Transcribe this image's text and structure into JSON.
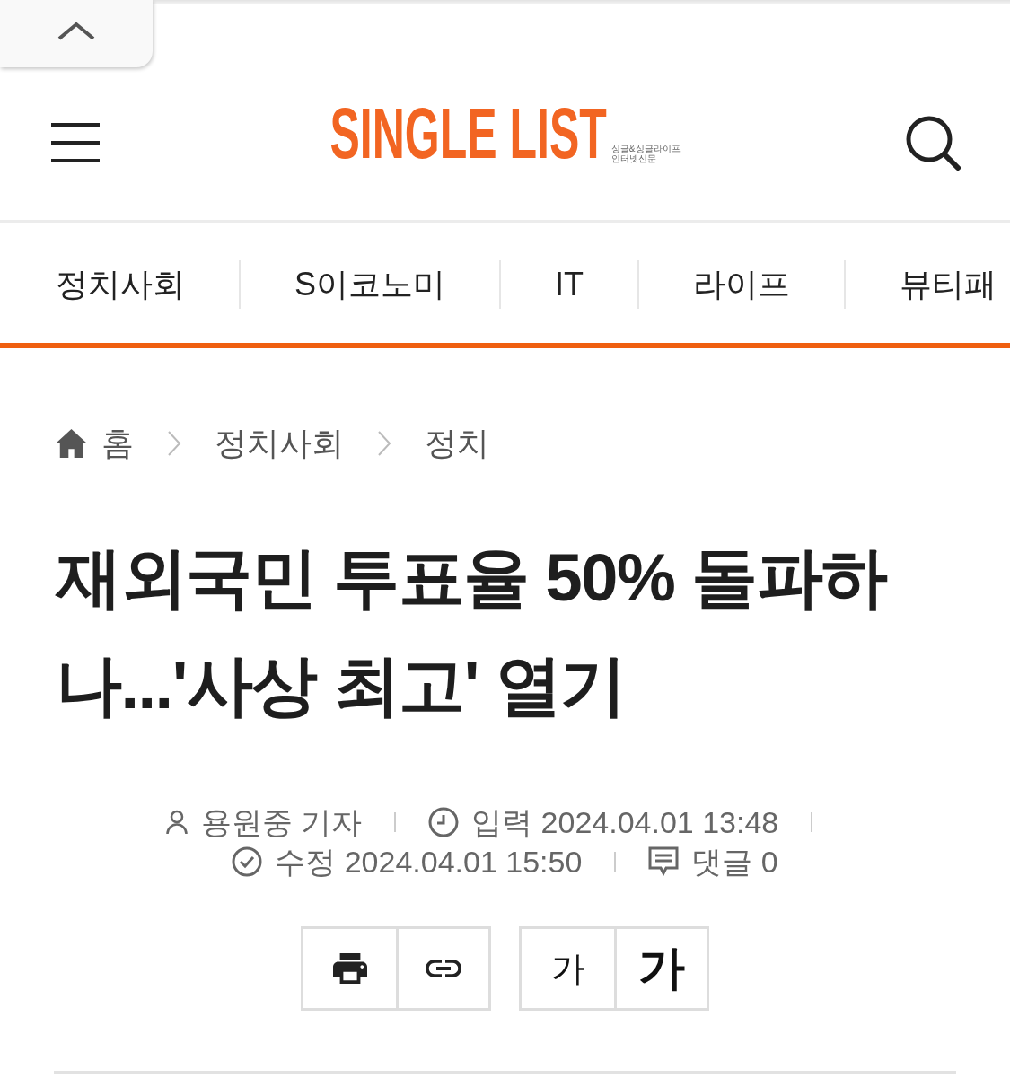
{
  "header": {
    "logo": {
      "wordmark": "SINGLE LIST",
      "tagline": [
        "싱글&싱글라이프",
        "인터넷신문"
      ]
    }
  },
  "nav": {
    "items": [
      "정치사회",
      "S이코노미",
      "IT",
      "라이프",
      "뷰티패"
    ]
  },
  "breadcrumb": {
    "items": [
      "홈",
      "정치사회",
      "정치"
    ]
  },
  "article": {
    "title": "재외국민 투표율 50% 돌파하나...'사상 최고' 열기",
    "meta": [
      {
        "kind": "author",
        "text": "용원중 기자"
      },
      {
        "kind": "published",
        "text": "입력 2024.04.01 13:48"
      },
      {
        "kind": "modified",
        "text": "수정 2024.04.01 15:50"
      },
      {
        "kind": "comments",
        "text": "댓글 0"
      }
    ],
    "font_size_buttons": [
      {
        "kind": "decrease",
        "label": "가"
      },
      {
        "kind": "increase",
        "label": "가"
      }
    ]
  }
}
